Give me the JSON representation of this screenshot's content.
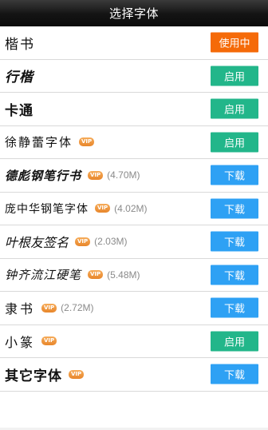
{
  "header": {
    "title": "选择字体"
  },
  "fonts": [
    {
      "name": "楷书",
      "vip": false,
      "size": "",
      "action": "使用中",
      "state": "inuse",
      "style": "n-kai"
    },
    {
      "name": "行楷",
      "vip": false,
      "size": "",
      "action": "启用",
      "state": "enable",
      "style": "n-xing"
    },
    {
      "name": "卡通",
      "vip": false,
      "size": "",
      "action": "启用",
      "state": "enable",
      "style": "n-kt"
    },
    {
      "name": "徐静蕾字体",
      "vip": true,
      "size": "",
      "action": "启用",
      "state": "enable",
      "style": "n-xu"
    },
    {
      "name": "德彪钢笔行书",
      "vip": true,
      "size": "(4.70M)",
      "action": "下载",
      "state": "download",
      "style": "n-hand"
    },
    {
      "name": "庞中华钢笔字体",
      "vip": true,
      "size": "(4.02M)",
      "action": "下载",
      "state": "download",
      "style": "n-pang"
    },
    {
      "name": "叶根友签名",
      "vip": true,
      "size": "(2.03M)",
      "action": "下载",
      "state": "download",
      "style": "n-ye"
    },
    {
      "name": "钟齐流江硬笔",
      "vip": true,
      "size": "(5.48M)",
      "action": "下载",
      "state": "download",
      "style": "n-zhong"
    },
    {
      "name": "隶书",
      "vip": true,
      "size": "(2.72M)",
      "action": "下载",
      "state": "download",
      "style": "n-li"
    },
    {
      "name": "小篆",
      "vip": true,
      "size": "",
      "action": "启用",
      "state": "enable",
      "style": "n-xz"
    },
    {
      "name": "其它字体",
      "vip": true,
      "size": "",
      "action": "下载",
      "state": "download",
      "style": "n-other"
    }
  ],
  "vip_badge": "VIP",
  "colors": {
    "inuse": "#f56a08",
    "enable": "#22b68a",
    "download": "#2ea1f4",
    "vip": "#e8862b"
  }
}
